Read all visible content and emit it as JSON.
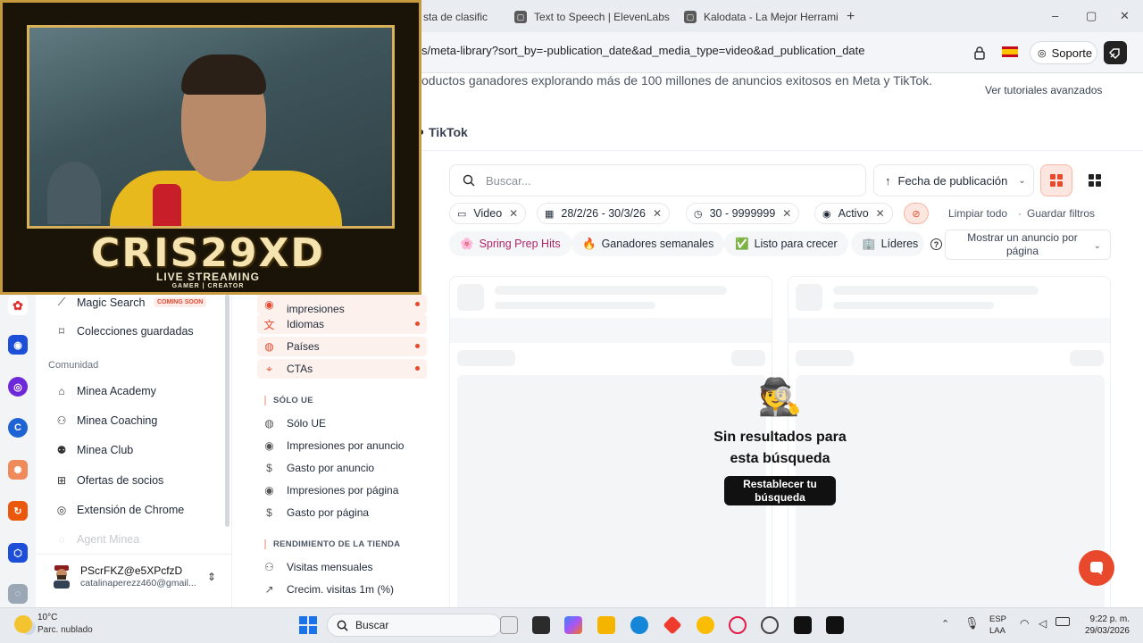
{
  "browser": {
    "tabs": [
      {
        "label": "sta de clasific",
        "icon": "page-icon"
      },
      {
        "label": "Text to Speech | ElevenLabs",
        "icon": "elevenlabs-icon"
      },
      {
        "label": "Kalodata - La Mejor Herrami",
        "icon": "kalodata-icon"
      }
    ],
    "new_tab": "+",
    "url": "s/meta-library?sort_by=-publication_date&ad_media_type=video&ad_publication_date",
    "support_label": "Soporte",
    "window_controls": [
      "–",
      "▢",
      "✕"
    ]
  },
  "page": {
    "subtitle": "oductos ganadores explorando más de 100 millones de anuncios exitosos en Meta y TikTok.",
    "tutorials": "Ver tutoriales avanzados",
    "platform_tab": "TikTok",
    "search_placeholder": "Buscar...",
    "sort_label": "Fecha de publicación",
    "filter_chips": [
      {
        "label": "Video",
        "icon": "video-icon"
      },
      {
        "label": "28/2/26 - 30/3/26",
        "icon": "calendar-icon"
      },
      {
        "label": "30 - 9999999",
        "icon": "clock-icon"
      },
      {
        "label": "Activo",
        "icon": "status-icon"
      }
    ],
    "clear_all": "Limpiar todo",
    "separator": "·",
    "save_filters": "Guardar filtros",
    "quick_filters": [
      {
        "label": "Spring Prep Hits",
        "emoji": "🌸"
      },
      {
        "label": "Ganadores semanales",
        "emoji": "🔥"
      },
      {
        "label": "Listo para crecer",
        "emoji": "✅"
      },
      {
        "label": "Líderes",
        "emoji": "🏢"
      }
    ],
    "per_page": "Mostrar un anuncio por página",
    "empty_state": {
      "emoji": "🕵️",
      "title": "Sin resultados para esta búsqueda",
      "button": "Restablecer tu búsqueda"
    }
  },
  "sidebar": {
    "items_top": [
      {
        "label": "Magic Search",
        "icon": "magic-wand-icon"
      },
      {
        "label": "Colecciones guardadas",
        "icon": "bookmark-icon"
      }
    ],
    "coming_soon": "COMING SOON",
    "community_heading": "Comunidad",
    "community_items": [
      {
        "label": "Minea Academy",
        "icon": "graduation-icon"
      },
      {
        "label": "Minea Coaching",
        "icon": "coaching-icon"
      },
      {
        "label": "Minea Club",
        "icon": "club-icon"
      },
      {
        "label": "Ofertas de socios",
        "icon": "gift-icon"
      },
      {
        "label": "Extensión de Chrome",
        "icon": "chrome-icon"
      },
      {
        "label": "Agent Minea",
        "icon": "agent-icon"
      }
    ],
    "user": {
      "name": "PScrFKZ@e5XPcfzD",
      "email": "catalinaperezz460@gmail..."
    }
  },
  "filters": {
    "highlighted": [
      {
        "label": "impresiones",
        "icon": "eye-icon"
      },
      {
        "label": "Idiomas",
        "icon": "translate-icon"
      },
      {
        "label": "Países",
        "icon": "globe-icon"
      },
      {
        "label": "CTAs",
        "icon": "cursor-icon"
      }
    ],
    "section_eu": "SÓLO UE",
    "eu_items": [
      {
        "label": "Sólo UE",
        "icon": "globe-icon"
      },
      {
        "label": "Impresiones por anuncio",
        "icon": "eye-icon"
      },
      {
        "label": "Gasto por anuncio",
        "icon": "dollar-icon"
      },
      {
        "label": "Impresiones por página",
        "icon": "eye-icon"
      },
      {
        "label": "Gasto por página",
        "icon": "dollar-icon"
      }
    ],
    "section_store": "RENDIMIENTO DE LA TIENDA",
    "store_items": [
      {
        "label": "Visitas mensuales",
        "icon": "users-icon"
      },
      {
        "label": "Crecim. visitas 1m (%)",
        "icon": "trend-icon"
      }
    ]
  },
  "stream_overlay": {
    "title": "CRIS29XD",
    "subtitle": "LIVE STREAMING",
    "tagline": "GAMER | CREATOR"
  },
  "taskbar": {
    "temperature": "10°C",
    "weather": "Parc. nublado",
    "search": "Buscar",
    "lang_top": "ESP",
    "lang_bottom": "LAA",
    "time": "9:22 p. m.",
    "date": "29/03/2026"
  },
  "colors": {
    "accent": "#e8482b",
    "text": "#1f2937"
  }
}
